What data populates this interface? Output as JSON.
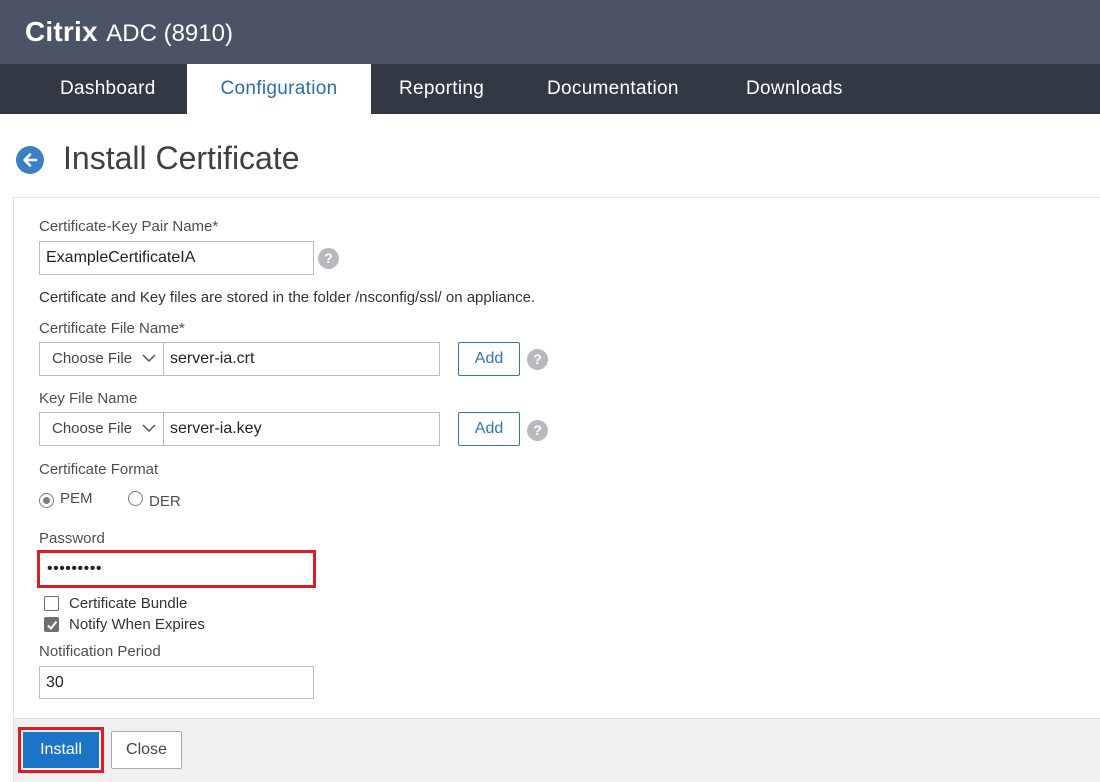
{
  "app": {
    "brand_name": "Citrix",
    "brand_model": "ADC (8910)"
  },
  "nav": {
    "tabs": [
      {
        "label": "Dashboard",
        "active": false
      },
      {
        "label": "Configuration",
        "active": true
      },
      {
        "label": "Reporting",
        "active": false
      },
      {
        "label": "Documentation",
        "active": false
      },
      {
        "label": "Downloads",
        "active": false
      }
    ]
  },
  "page": {
    "title": "Install Certificate",
    "back_icon": "arrow-left-circle-icon"
  },
  "form": {
    "cert_key_pair": {
      "label": "Certificate-Key Pair Name*",
      "value": "ExampleCertificateIA",
      "help_icon": "?"
    },
    "folder_note": "Certificate and Key files are stored in the folder /nsconfig/ssl/ on appliance.",
    "cert_file": {
      "label": "Certificate File Name*",
      "choose_label": "Choose File",
      "value": "server-ia.crt",
      "add_label": "Add",
      "help_icon": "?"
    },
    "key_file": {
      "label": "Key File Name",
      "choose_label": "Choose File",
      "value": "server-ia.key",
      "add_label": "Add",
      "help_icon": "?"
    },
    "cert_format": {
      "label": "Certificate Format",
      "options": [
        {
          "label": "PEM",
          "selected": true
        },
        {
          "label": "DER",
          "selected": false
        }
      ]
    },
    "password": {
      "label": "Password",
      "value": "•••••••••"
    },
    "cert_bundle": {
      "label": "Certificate Bundle",
      "checked": false
    },
    "notify_expires": {
      "label": "Notify When Expires",
      "checked": true
    },
    "notification_period": {
      "label": "Notification Period",
      "value": "30"
    }
  },
  "footer": {
    "install_label": "Install",
    "close_label": "Close"
  },
  "colors": {
    "header_bg": "#4b5467",
    "nav_bg": "#323944",
    "accent_blue": "#1b74c5",
    "highlight_red": "#e01b24"
  }
}
